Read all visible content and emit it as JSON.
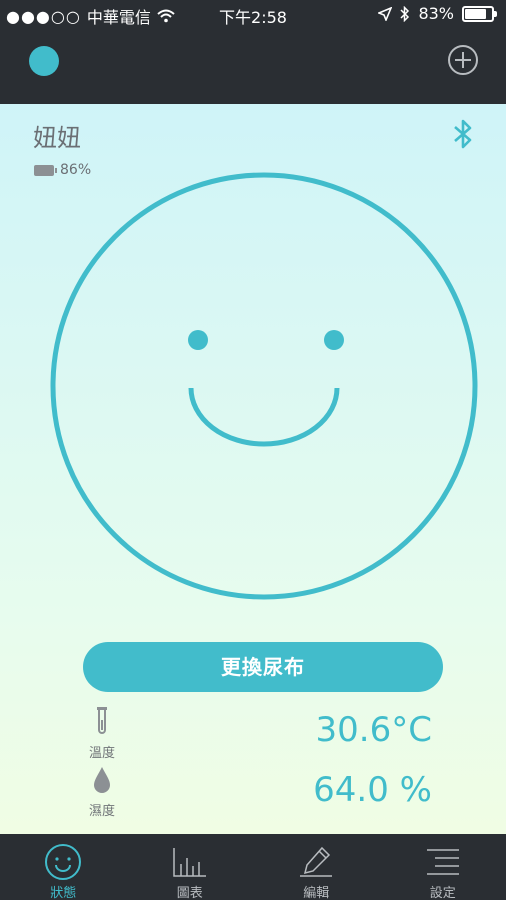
{
  "status_bar": {
    "signal_dots": "●●●○○",
    "carrier": "中華電信",
    "time": "下午2:58",
    "battery_percent": "83%",
    "battery_level": 0.83
  },
  "header": {
    "profile_color": "#41bccb"
  },
  "main": {
    "baby_name": "妞妞",
    "device_battery": "86%",
    "mood": "happy",
    "change_button": "更換尿布",
    "readings": [
      {
        "label": "溫度",
        "value": "30.6°C"
      },
      {
        "label": "濕度",
        "value": "64.0 %"
      }
    ]
  },
  "tabs": [
    {
      "label": "狀態",
      "icon": "smile-icon",
      "active": true
    },
    {
      "label": "圖表",
      "icon": "bar-chart-icon",
      "active": false
    },
    {
      "label": "編輯",
      "icon": "pencil-icon",
      "active": false
    },
    {
      "label": "設定",
      "icon": "menu-icon",
      "active": false
    }
  ],
  "colors": {
    "accent": "#41bccb",
    "dark": "#2a2e33",
    "text_gray": "#6b6f74"
  }
}
